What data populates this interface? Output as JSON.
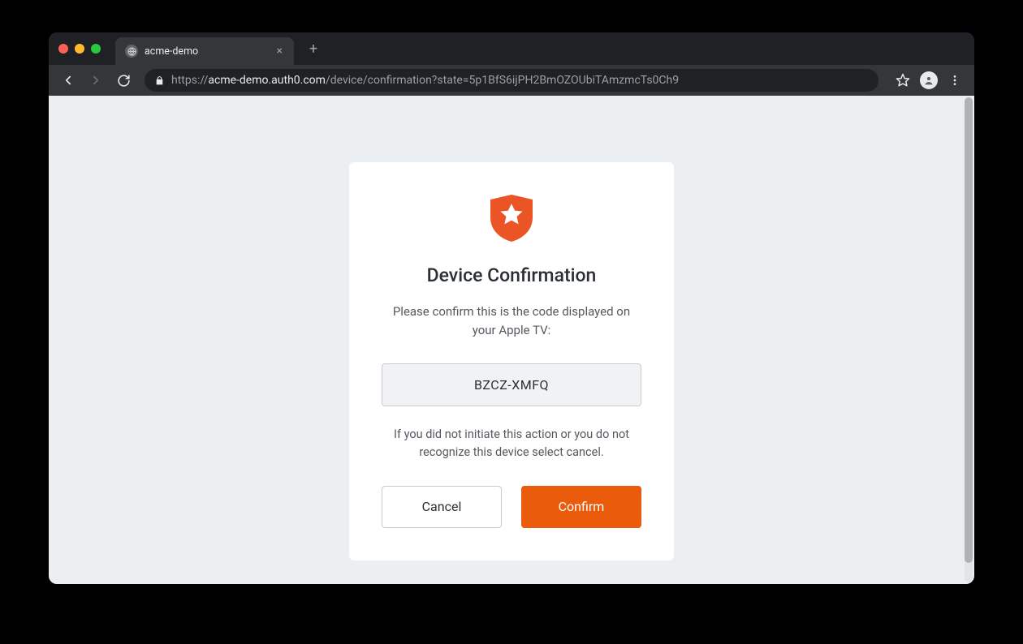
{
  "browser": {
    "tab_title": "acme-demo",
    "url": {
      "prefix": "https://",
      "domain": "acme-demo.auth0.com",
      "path": "/device/confirmation?state=5p1BfS6ijPH2BmOZOUbiTAmzmcTs0Ch9"
    }
  },
  "dialog": {
    "heading": "Device Confirmation",
    "prompt": "Please confirm this is the code displayed on your Apple TV:",
    "code": "BZCZ-XMFQ",
    "warning": "If you did not initiate this action or you do not recognize this device select cancel.",
    "cancel_label": "Cancel",
    "confirm_label": "Confirm"
  },
  "colors": {
    "accent": "#ea5b0c"
  }
}
